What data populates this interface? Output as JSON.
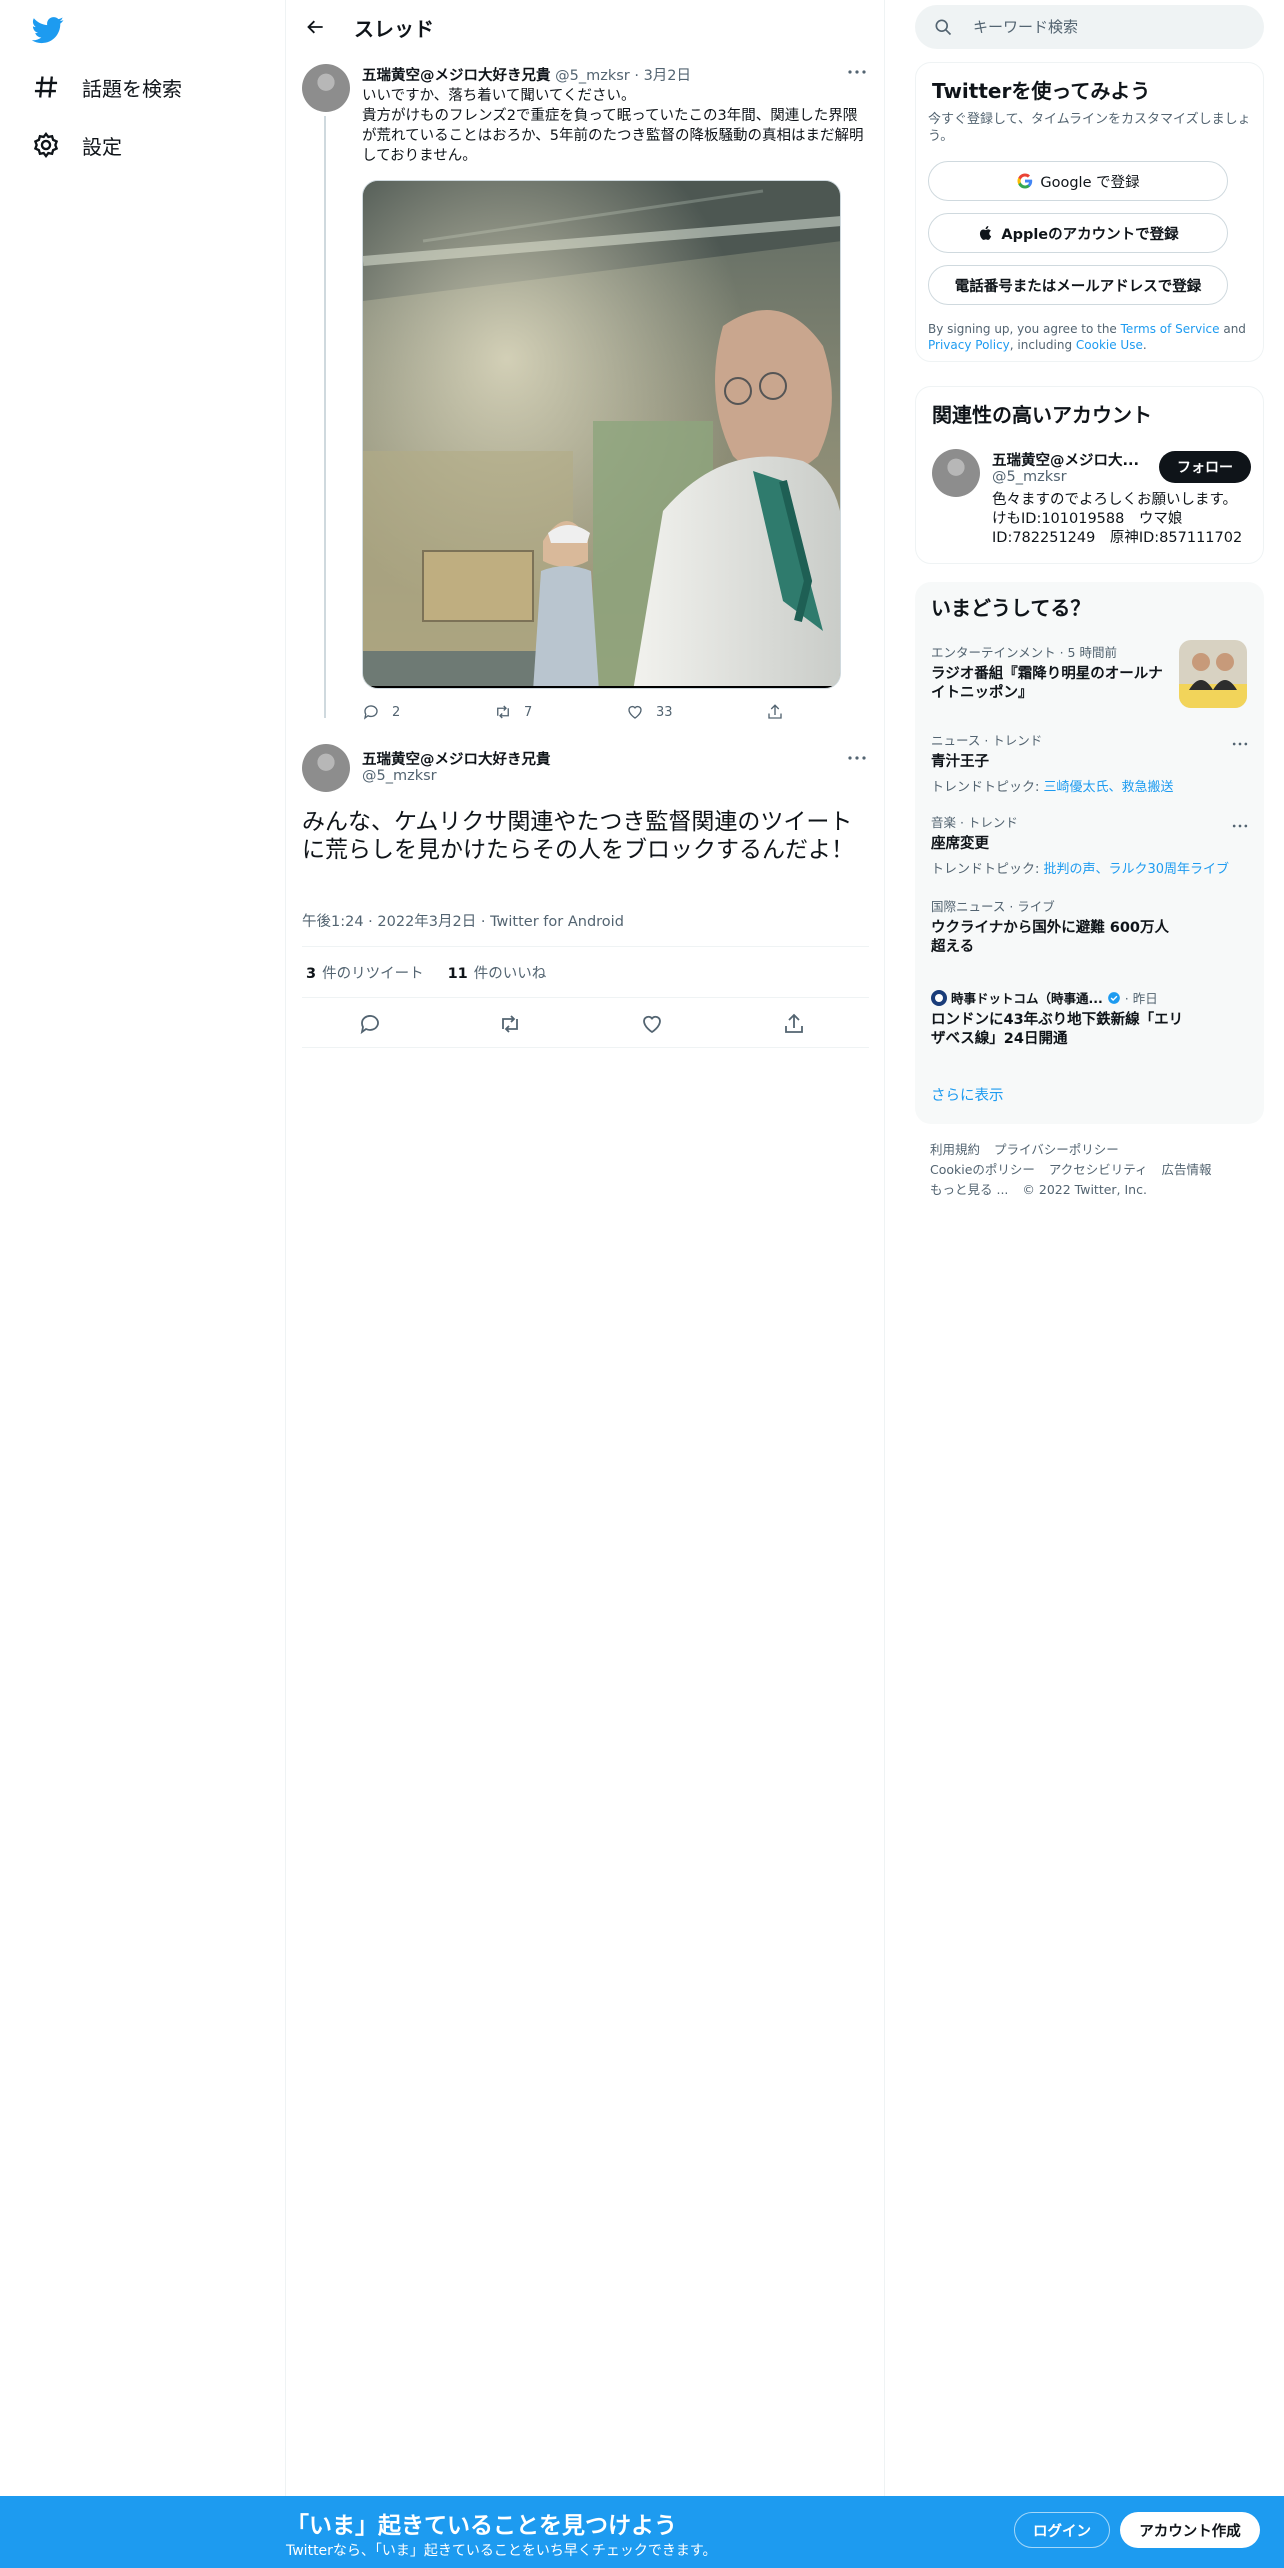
{
  "nav": {
    "items": [
      {
        "label": "話題を検索",
        "icon": "hashtag-icon"
      },
      {
        "label": "設定",
        "icon": "gear-icon"
      }
    ]
  },
  "header": {
    "title": "スレッド"
  },
  "thread": {
    "parent": {
      "user_name": "五瑞黄空@メジロ大好き兄貴",
      "handle": "@5_mzksr",
      "separator": "·",
      "date": "3月2日",
      "text": "いいですか、落ち着いて聞いてください。\n貴方がけものフレンズ2で重症を負って眠っていたこの3年間、関連した界隈が荒れていることはおろか、5年前のたつき監督の降板騒動の真相はまだ解明しておりません。",
      "reply_count": "2",
      "retweet_count": "7",
      "like_count": "33"
    },
    "main": {
      "user_name": "五瑞黄空@メジロ大好き兄貴",
      "handle": "@5_mzksr",
      "text": "みんな、ケムリクサ関連やたつき監督関連のツイートに荒らしを見かけたらその人をブロックするんだよ！",
      "time": "午後1:24",
      "separator": "·",
      "date": "2022年3月2日",
      "source": "Twitter for Android",
      "retweets": "3",
      "retweets_label": "件のリツイート",
      "likes": "11",
      "likes_label": "件のいいね"
    }
  },
  "search": {
    "placeholder": "キーワード検索"
  },
  "signup": {
    "title": "Twitterを使ってみよう",
    "subtitle": "今すぐ登録して、タイムラインをカスタマイズしましょう。",
    "google_label": "Google で登録",
    "apple_label": "Appleのアカウントで登録",
    "phone_label": "電話番号またはメールアドレスで登録",
    "legal_prefix": "By signing up, you agree to the ",
    "tos": "Terms of Service",
    "and": " and ",
    "privacy": "Privacy Policy",
    "including": ", including ",
    "cookie": "Cookie Use",
    "period": "."
  },
  "relevant": {
    "title": "関連性の高いアカウント",
    "name": "五瑞黄空@メジロ大...",
    "handle": "@5_mzksr",
    "bio": "色々ますのでよろしくお願いします。 けもID:101019588　ウマ娘ID:782251249　原神ID:857111702",
    "follow_label": "フォロー"
  },
  "trends": {
    "title": "いまどうしてる？",
    "items": [
      {
        "context": "エンターテインメント · 5 時間前",
        "title": "ラジオ番組『霜降り明星のオールナイトニッポン』"
      },
      {
        "context": "ニュース · トレンド",
        "title": "青汁王子",
        "topic_prefix": "トレンドトピック: ",
        "topic_links": "三崎優太氏、救急搬送"
      },
      {
        "context": "音楽 · トレンド",
        "title": "座席変更",
        "topic_prefix": "トレンドトピック: ",
        "topic_links": "批判の声、ラルク30周年ライブ"
      },
      {
        "context": "国際ニュース · ライブ",
        "title": "ウクライナから国外に避難 600万人超える"
      },
      {
        "context_source": "時事ドットコム（時事通...",
        "context_time": "· 昨日",
        "title": "ロンドンに43年ぶり地下鉄新線「エリザベス線」24日開通"
      }
    ],
    "show_more": "さらに表示"
  },
  "footer": {
    "links": [
      "利用規約",
      "プライバシーポリシー",
      "Cookieのポリシー",
      "アクセシビリティ",
      "広告情報",
      "もっと見る ..."
    ],
    "copyright": "© 2022 Twitter, Inc."
  },
  "banner": {
    "title": "「いま」起きていることを見つけよう",
    "subtitle": "Twitterなら、「いま」起きていることをいち早くチェックできます。",
    "login": "ログイン",
    "signup": "アカウント作成"
  },
  "colors": {
    "accent": "#1d9bf0",
    "text": "#0f1419",
    "secondary": "#536471"
  }
}
